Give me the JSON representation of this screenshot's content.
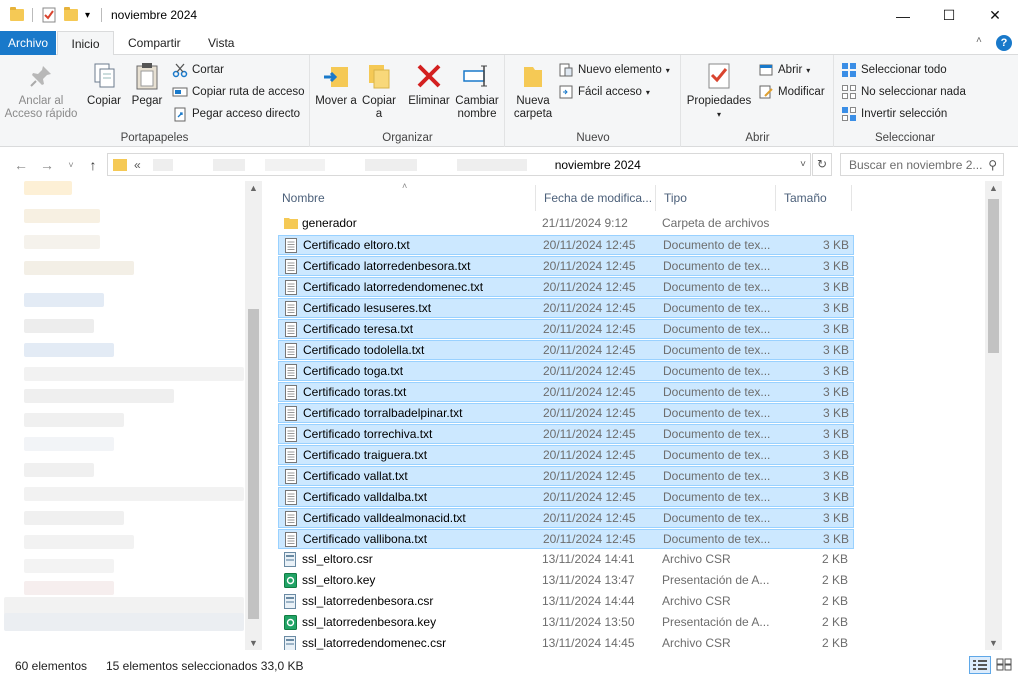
{
  "window": {
    "title": "noviembre 2024",
    "minimize": "—",
    "maximize": "☐",
    "close": "✕"
  },
  "tabs": [
    {
      "label": "Archivo"
    },
    {
      "label": "Inicio"
    },
    {
      "label": "Compartir"
    },
    {
      "label": "Vista"
    }
  ],
  "ribbon": {
    "portapapeles": {
      "group_label": "Portapapeles",
      "anclar": "Anclar al Acceso rápido",
      "copiar": "Copiar",
      "pegar": "Pegar",
      "cortar": "Cortar",
      "copiar_ruta": "Copiar ruta de acceso",
      "pegar_acceso": "Pegar acceso directo"
    },
    "organizar": {
      "group_label": "Organizar",
      "mover": "Mover a",
      "copiar": "Copiar a",
      "eliminar": "Eliminar",
      "cambiar": "Cambiar nombre"
    },
    "nuevo": {
      "group_label": "Nuevo",
      "nueva_carpeta": "Nueva carpeta",
      "nuevo_elemento": "Nuevo elemento",
      "facil_acceso": "Fácil acceso"
    },
    "abrir": {
      "group_label": "Abrir",
      "propiedades": "Propiedades",
      "abrir": "Abrir",
      "modificar": "Modificar"
    },
    "seleccionar": {
      "group_label": "Seleccionar",
      "todo": "Seleccionar todo",
      "ninguno": "No seleccionar nada",
      "invertir": "Invertir selección"
    }
  },
  "address": {
    "prefix": "«",
    "current": "noviembre 2024",
    "search_placeholder": "Buscar en noviembre 2..."
  },
  "columns": {
    "name": "Nombre",
    "date": "Fecha de modifica...",
    "type": "Tipo",
    "size": "Tamaño"
  },
  "files": [
    {
      "name": "generador",
      "date": "21/11/2024 9:12",
      "type": "Carpeta de archivos",
      "size": "",
      "icon": "folder",
      "selected": false
    },
    {
      "name": "Certificado eltoro.txt",
      "date": "20/11/2024 12:45",
      "type": "Documento de tex...",
      "size": "3 KB",
      "icon": "txt",
      "selected": true
    },
    {
      "name": "Certificado latorredenbesora.txt",
      "date": "20/11/2024 12:45",
      "type": "Documento de tex...",
      "size": "3 KB",
      "icon": "txt",
      "selected": true
    },
    {
      "name": "Certificado latorredendomenec.txt",
      "date": "20/11/2024 12:45",
      "type": "Documento de tex...",
      "size": "3 KB",
      "icon": "txt",
      "selected": true
    },
    {
      "name": "Certificado lesuseres.txt",
      "date": "20/11/2024 12:45",
      "type": "Documento de tex...",
      "size": "3 KB",
      "icon": "txt",
      "selected": true
    },
    {
      "name": "Certificado teresa.txt",
      "date": "20/11/2024 12:45",
      "type": "Documento de tex...",
      "size": "3 KB",
      "icon": "txt",
      "selected": true
    },
    {
      "name": "Certificado todolella.txt",
      "date": "20/11/2024 12:45",
      "type": "Documento de tex...",
      "size": "3 KB",
      "icon": "txt",
      "selected": true
    },
    {
      "name": "Certificado toga.txt",
      "date": "20/11/2024 12:45",
      "type": "Documento de tex...",
      "size": "3 KB",
      "icon": "txt",
      "selected": true
    },
    {
      "name": "Certificado toras.txt",
      "date": "20/11/2024 12:45",
      "type": "Documento de tex...",
      "size": "3 KB",
      "icon": "txt",
      "selected": true
    },
    {
      "name": "Certificado torralbadelpinar.txt",
      "date": "20/11/2024 12:45",
      "type": "Documento de tex...",
      "size": "3 KB",
      "icon": "txt",
      "selected": true
    },
    {
      "name": "Certificado torrechiva.txt",
      "date": "20/11/2024 12:45",
      "type": "Documento de tex...",
      "size": "3 KB",
      "icon": "txt",
      "selected": true
    },
    {
      "name": "Certificado traiguera.txt",
      "date": "20/11/2024 12:45",
      "type": "Documento de tex...",
      "size": "3 KB",
      "icon": "txt",
      "selected": true
    },
    {
      "name": "Certificado vallat.txt",
      "date": "20/11/2024 12:45",
      "type": "Documento de tex...",
      "size": "3 KB",
      "icon": "txt",
      "selected": true
    },
    {
      "name": "Certificado valldalba.txt",
      "date": "20/11/2024 12:45",
      "type": "Documento de tex...",
      "size": "3 KB",
      "icon": "txt",
      "selected": true
    },
    {
      "name": "Certificado valldealmonacid.txt",
      "date": "20/11/2024 12:45",
      "type": "Documento de tex...",
      "size": "3 KB",
      "icon": "txt",
      "selected": true
    },
    {
      "name": "Certificado vallibona.txt",
      "date": "20/11/2024 12:45",
      "type": "Documento de tex...",
      "size": "3 KB",
      "icon": "txt",
      "selected": true
    },
    {
      "name": "ssl_eltoro.csr",
      "date": "13/11/2024 14:41",
      "type": "Archivo CSR",
      "size": "2 KB",
      "icon": "csr",
      "selected": false
    },
    {
      "name": "ssl_eltoro.key",
      "date": "13/11/2024 13:47",
      "type": "Presentación de A...",
      "size": "2 KB",
      "icon": "key",
      "selected": false
    },
    {
      "name": "ssl_latorredenbesora.csr",
      "date": "13/11/2024 14:44",
      "type": "Archivo CSR",
      "size": "2 KB",
      "icon": "csr",
      "selected": false
    },
    {
      "name": "ssl_latorredenbesora.key",
      "date": "13/11/2024 13:50",
      "type": "Presentación de A...",
      "size": "2 KB",
      "icon": "key",
      "selected": false
    },
    {
      "name": "ssl_latorredendomenec.csr",
      "date": "13/11/2024 14:45",
      "type": "Archivo CSR",
      "size": "2 KB",
      "icon": "csr",
      "selected": false
    }
  ],
  "status": {
    "count": "60 elementos",
    "selected": "15 elementos seleccionados  33,0 KB"
  },
  "colors": {
    "accent": "#1979ca",
    "selection_bg": "#cce8ff",
    "selection_border": "#99d1ff",
    "folder": "#f5c955"
  }
}
